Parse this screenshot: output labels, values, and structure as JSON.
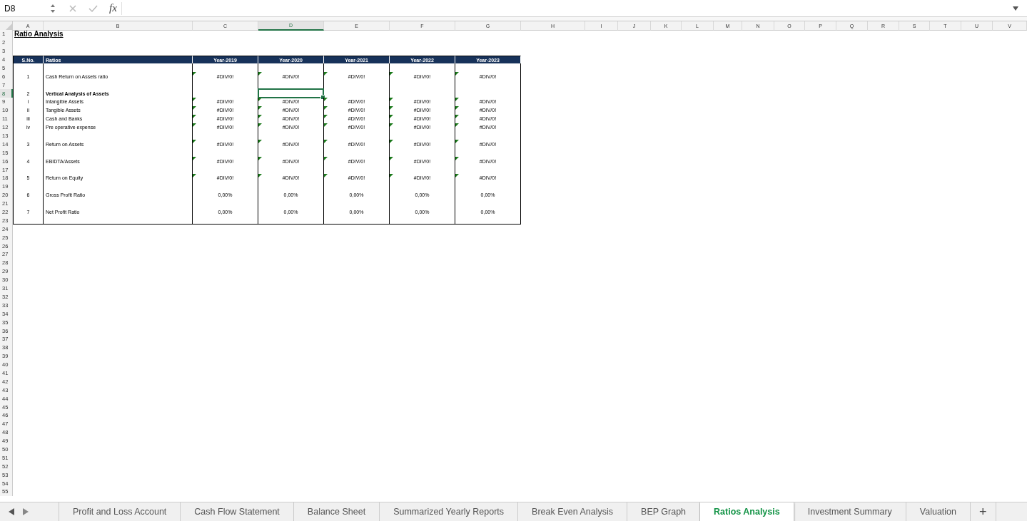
{
  "name_box": "D8",
  "formula_bar": {
    "function_label": "fx"
  },
  "columns": [
    {
      "label": "A",
      "selected": false
    },
    {
      "label": "B",
      "selected": false
    },
    {
      "label": "C",
      "selected": false
    },
    {
      "label": "D",
      "selected": true
    },
    {
      "label": "E",
      "selected": false
    },
    {
      "label": "F",
      "selected": false
    },
    {
      "label": "G",
      "selected": false
    },
    {
      "label": "H",
      "selected": false
    },
    {
      "label": "I",
      "selected": false
    },
    {
      "label": "J",
      "selected": false
    },
    {
      "label": "K",
      "selected": false
    },
    {
      "label": "L",
      "selected": false
    },
    {
      "label": "M",
      "selected": false
    },
    {
      "label": "N",
      "selected": false
    },
    {
      "label": "O",
      "selected": false
    },
    {
      "label": "P",
      "selected": false
    },
    {
      "label": "Q",
      "selected": false
    },
    {
      "label": "R",
      "selected": false
    },
    {
      "label": "S",
      "selected": false
    },
    {
      "label": "T",
      "selected": false
    },
    {
      "label": "U",
      "selected": false
    },
    {
      "label": "V",
      "selected": false
    }
  ],
  "rows": [
    {
      "number": "1",
      "selected": false,
      "kind": "title",
      "text": "Ratio Analysis"
    },
    {
      "number": "2",
      "selected": false,
      "kind": "empty"
    },
    {
      "number": "3",
      "selected": false,
      "kind": "empty"
    },
    {
      "number": "4",
      "selected": false,
      "kind": "table_header",
      "cells": [
        "S.No.",
        "Ratios",
        "Year-2019",
        "Year-2020",
        "Year-2021",
        "Year-2022",
        "Year-2023"
      ]
    },
    {
      "number": "5",
      "selected": false,
      "kind": "spacer"
    },
    {
      "number": "6",
      "selected": false,
      "kind": "item",
      "sno": "1",
      "ratio": "Cash Return on Assets ratio",
      "values": [
        "#DIV/0!",
        "#DIV/0!",
        "#DIV/0!",
        "#DIV/0!",
        "#DIV/0!"
      ],
      "flagged": true
    },
    {
      "number": "7",
      "selected": false,
      "kind": "spacer"
    },
    {
      "number": "8",
      "selected": true,
      "kind": "section",
      "sno": "2",
      "ratio": "Vertical Analysis of Assets"
    },
    {
      "number": "9",
      "selected": false,
      "kind": "item",
      "sno": "i",
      "ratio": "Intangible Assets",
      "values": [
        "#DIV/0!",
        "#DIV/0!",
        "#DIV/0!",
        "#DIV/0!",
        "#DIV/0!"
      ],
      "flagged": true
    },
    {
      "number": "10",
      "selected": false,
      "kind": "item",
      "sno": "ii",
      "ratio": "Tangible Assets",
      "values": [
        "#DIV/0!",
        "#DIV/0!",
        "#DIV/0!",
        "#DIV/0!",
        "#DIV/0!"
      ],
      "flagged": true
    },
    {
      "number": "11",
      "selected": false,
      "kind": "item",
      "sno": "iii",
      "ratio": "Cash and Banks",
      "values": [
        "#DIV/0!",
        "#DIV/0!",
        "#DIV/0!",
        "#DIV/0!",
        "#DIV/0!"
      ],
      "flagged": true
    },
    {
      "number": "12",
      "selected": false,
      "kind": "item",
      "sno": "iv",
      "ratio": "Pre operative expense",
      "values": [
        "#DIV/0!",
        "#DIV/0!",
        "#DIV/0!",
        "#DIV/0!",
        "#DIV/0!"
      ],
      "flagged": true
    },
    {
      "number": "13",
      "selected": false,
      "kind": "spacer"
    },
    {
      "number": "14",
      "selected": false,
      "kind": "item",
      "sno": "3",
      "ratio": "Return on Assets",
      "values": [
        "#DIV/0!",
        "#DIV/0!",
        "#DIV/0!",
        "#DIV/0!",
        "#DIV/0!"
      ],
      "flagged": true
    },
    {
      "number": "15",
      "selected": false,
      "kind": "spacer"
    },
    {
      "number": "16",
      "selected": false,
      "kind": "item",
      "sno": "4",
      "ratio": "EBIDTA/Assets",
      "values": [
        "#DIV/0!",
        "#DIV/0!",
        "#DIV/0!",
        "#DIV/0!",
        "#DIV/0!"
      ],
      "flagged": true
    },
    {
      "number": "17",
      "selected": false,
      "kind": "spacer"
    },
    {
      "number": "18",
      "selected": false,
      "kind": "item",
      "sno": "5",
      "ratio": "Return on Equity",
      "values": [
        "#DIV/0!",
        "#DIV/0!",
        "#DIV/0!",
        "#DIV/0!",
        "#DIV/0!"
      ],
      "flagged": true
    },
    {
      "number": "19",
      "selected": false,
      "kind": "spacer"
    },
    {
      "number": "20",
      "selected": false,
      "kind": "item",
      "sno": "6",
      "ratio": "Gross Profit Ratio",
      "values": [
        "0,00%",
        "0,00%",
        "0,00%",
        "0,00%",
        "0,00%"
      ],
      "flagged": false
    },
    {
      "number": "21",
      "selected": false,
      "kind": "spacer"
    },
    {
      "number": "22",
      "selected": false,
      "kind": "item",
      "sno": "7",
      "ratio": "Net Profit Ratio",
      "values": [
        "0,00%",
        "0,00%",
        "0,00%",
        "0,00%",
        "0,00%"
      ],
      "flagged": false
    },
    {
      "number": "23",
      "selected": false,
      "kind": "spacer"
    },
    {
      "number": "24",
      "selected": false,
      "kind": "empty"
    },
    {
      "number": "25",
      "selected": false,
      "kind": "empty"
    },
    {
      "number": "26",
      "selected": false,
      "kind": "empty"
    },
    {
      "number": "27",
      "selected": false,
      "kind": "empty"
    },
    {
      "number": "28",
      "selected": false,
      "kind": "empty"
    },
    {
      "number": "29",
      "selected": false,
      "kind": "empty"
    },
    {
      "number": "30",
      "selected": false,
      "kind": "empty"
    },
    {
      "number": "31",
      "selected": false,
      "kind": "empty"
    },
    {
      "number": "32",
      "selected": false,
      "kind": "empty"
    },
    {
      "number": "33",
      "selected": false,
      "kind": "empty"
    },
    {
      "number": "34",
      "selected": false,
      "kind": "empty"
    },
    {
      "number": "35",
      "selected": false,
      "kind": "empty"
    },
    {
      "number": "36",
      "selected": false,
      "kind": "empty"
    },
    {
      "number": "37",
      "selected": false,
      "kind": "empty"
    },
    {
      "number": "38",
      "selected": false,
      "kind": "empty"
    },
    {
      "number": "39",
      "selected": false,
      "kind": "empty"
    },
    {
      "number": "40",
      "selected": false,
      "kind": "empty"
    },
    {
      "number": "41",
      "selected": false,
      "kind": "empty"
    },
    {
      "number": "42",
      "selected": false,
      "kind": "empty"
    },
    {
      "number": "43",
      "selected": false,
      "kind": "empty"
    },
    {
      "number": "44",
      "selected": false,
      "kind": "empty"
    },
    {
      "number": "45",
      "selected": false,
      "kind": "empty"
    },
    {
      "number": "46",
      "selected": false,
      "kind": "empty"
    },
    {
      "number": "47",
      "selected": false,
      "kind": "empty"
    },
    {
      "number": "48",
      "selected": false,
      "kind": "empty"
    },
    {
      "number": "49",
      "selected": false,
      "kind": "empty"
    },
    {
      "number": "50",
      "selected": false,
      "kind": "empty"
    },
    {
      "number": "51",
      "selected": false,
      "kind": "empty"
    },
    {
      "number": "52",
      "selected": false,
      "kind": "empty"
    },
    {
      "number": "53",
      "selected": false,
      "kind": "empty"
    },
    {
      "number": "54",
      "selected": false,
      "kind": "empty"
    },
    {
      "number": "55",
      "selected": false,
      "kind": "empty"
    }
  ],
  "sheet_tabs": [
    {
      "label": "Profit and Loss Account",
      "selected": false
    },
    {
      "label": "Cash Flow Statement",
      "selected": false
    },
    {
      "label": "Balance Sheet",
      "selected": false
    },
    {
      "label": "Summarized Yearly Reports",
      "selected": false
    },
    {
      "label": "Break Even Analysis",
      "selected": false
    },
    {
      "label": "BEP Graph",
      "selected": false
    },
    {
      "label": "Ratios Analysis",
      "selected": true
    },
    {
      "label": "Investment Summary",
      "selected": false
    },
    {
      "label": "Valuation",
      "selected": false
    }
  ],
  "add_sheet": "+"
}
